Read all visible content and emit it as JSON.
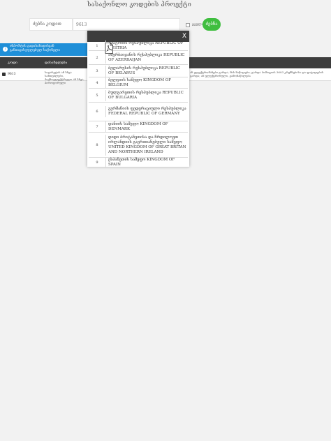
{
  "page": {
    "title": "სასაქონლო კოდების პროექტი"
  },
  "search": {
    "label": "ძებნა კოდით",
    "value": "9613",
    "checkbox_label": "ყველა",
    "button_label": "ძებნა"
  },
  "info_banner": {
    "text": "ინპორტის გადასახადისგან განთავისუფლებულ საქონელი"
  },
  "table": {
    "headers": [
      "კოდი",
      "დასახელება"
    ],
    "row": {
      "code": "9613",
      "desc_left": "სიგარეტის ან სხვა სანთებლები, პიეზოელექტრული ან სხვა, პიროფორული",
      "desc_right": "ან ელექტრომანები გარდა, მის ნაწილები, გარდა პოზიციის 3603 კრემნებისა და ფიტილების გარდა; ან ელექტრონული, გამონაწილება"
    }
  },
  "modal": {
    "close_label": "X",
    "items": [
      {
        "num": "1",
        "label": "ავსტრიის რესპუბლიკა REPUBLIC OF AUSTRIA"
      },
      {
        "num": "2",
        "label": "აზერბაიჯანის რესპუბლიკა REPUBLIC OF AZERBAIJAN"
      },
      {
        "num": "3",
        "label": "ბელარუსის რესპუბლიკა REPUBLIC OF BELARUS"
      },
      {
        "num": "4",
        "label": "ბელგიის სამეფო KINGDOM OF BELGIUM"
      },
      {
        "num": "5",
        "label": "ბულგარეთის რესპუბლიკა REPUBLIC OF BULGARIA"
      },
      {
        "num": "6",
        "label": "გერმანიის ფედერაციული რესპუბლიკა FEDERAL REPUBLIC OF GERMANY"
      },
      {
        "num": "7",
        "label": "დანიის სამეფო KINGDOM OF DENMARK"
      },
      {
        "num": "8",
        "label": "დიდი ბრიტანეთისა და ჩრდილოეთ ირლანდიის გაერთიანებული სამეფო UNITED KINGDOM OF GREAT BRITAN AND NORTHERN IRELAND"
      },
      {
        "num": "9",
        "label": "ესპანეთის სამეფო KINGDOM OF SPAIN"
      }
    ]
  },
  "colors": {
    "accent_green": "#3fbe3f",
    "banner_blue": "#1f8fd8",
    "header_dark": "#3d3d3d"
  }
}
